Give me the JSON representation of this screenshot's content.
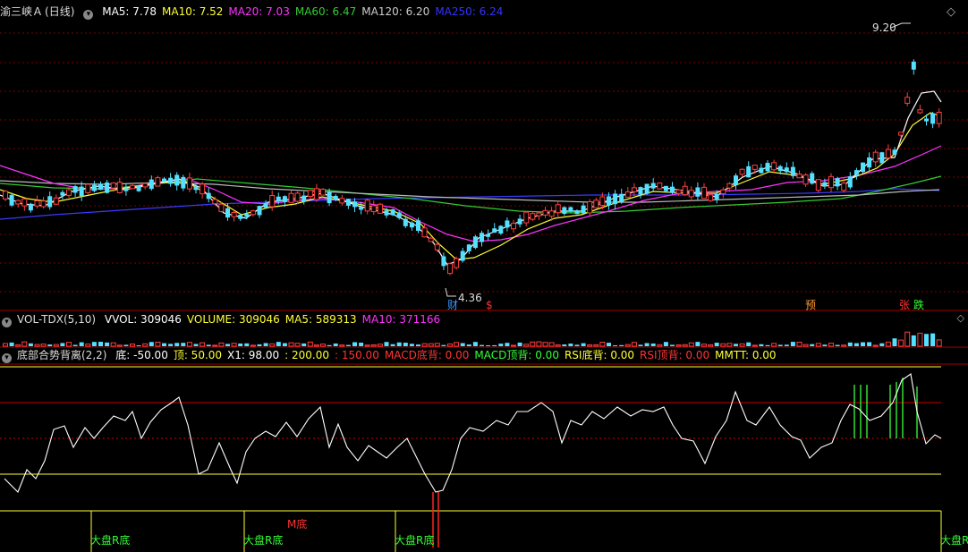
{
  "main": {
    "title": "渝三峡Ａ",
    "period": "(日线)",
    "ma": [
      {
        "label": "MA5: ",
        "value": "7.78",
        "color": "#ffffff"
      },
      {
        "label": "MA10: ",
        "value": "7.52",
        "color": "#ffff33"
      },
      {
        "label": "MA20: ",
        "value": "7.03",
        "color": "#ff33ff"
      },
      {
        "label": "MA60: ",
        "value": "6.47",
        "color": "#33cc33"
      },
      {
        "label": "MA120: ",
        "value": "6.20",
        "color": "#cccccc"
      },
      {
        "label": "MA250: ",
        "value": "6.24",
        "color": "#3333ff"
      }
    ],
    "high_label": "9.20",
    "low_label": "4.36",
    "markers": [
      {
        "text": "财",
        "color": "#3399ff"
      },
      {
        "text": "$",
        "color": "#ff3333"
      },
      {
        "text": "预",
        "color": "#ff9933"
      },
      {
        "text": "张",
        "color": "#ff3333"
      },
      {
        "text": "跌",
        "color": "#33ff33"
      }
    ]
  },
  "vol": {
    "name": "VOL-TDX(5,10)",
    "items": [
      {
        "label": "VVOL: ",
        "value": "309046",
        "color": "#ffffff"
      },
      {
        "label": "VOLUME: ",
        "value": "309046",
        "color": "#ffff33"
      },
      {
        "label": "MA5: ",
        "value": "589313",
        "color": "#ffff33"
      },
      {
        "label": "MA10: ",
        "value": "371166",
        "color": "#ff33ff"
      }
    ]
  },
  "ind": {
    "name": "底部合势背离(2,2)",
    "items": [
      {
        "label": "底: ",
        "value": "-50.00",
        "color": "#ffffff"
      },
      {
        "label": "顶: ",
        "value": "50.00",
        "color": "#ffff33"
      },
      {
        "label": "X1: ",
        "value": "98.00",
        "color": "#ffffff"
      },
      {
        "label": ": ",
        "value": "200.00",
        "color": "#ffff33"
      },
      {
        "label": ": ",
        "value": "150.00",
        "color": "#ff3333"
      },
      {
        "label": "MACD底背: ",
        "value": "0.00",
        "color": "#ff3333"
      },
      {
        "label": "MACD顶背: ",
        "value": "0.00",
        "color": "#33ff33"
      },
      {
        "label": "RSI底背: ",
        "value": "0.00",
        "color": "#ffff33"
      },
      {
        "label": "RSI顶背: ",
        "value": "0.00",
        "color": "#ff3333"
      },
      {
        "label": "MMTT: ",
        "value": "0.00",
        "color": "#ffff33"
      }
    ],
    "signals": [
      {
        "text": "大盘R底",
        "color": "#33ff33"
      },
      {
        "text": "大盘R底",
        "color": "#33ff33"
      },
      {
        "text": "M底",
        "color": "#ff3333"
      },
      {
        "text": "大盘R底",
        "color": "#33ff33"
      },
      {
        "text": "大盘R",
        "color": "#33ff33"
      }
    ]
  },
  "icons": {
    "collapse": "chevron-down-icon",
    "scroll_up": "caret-up-icon",
    "scroll_down": "diamond-icon"
  }
}
